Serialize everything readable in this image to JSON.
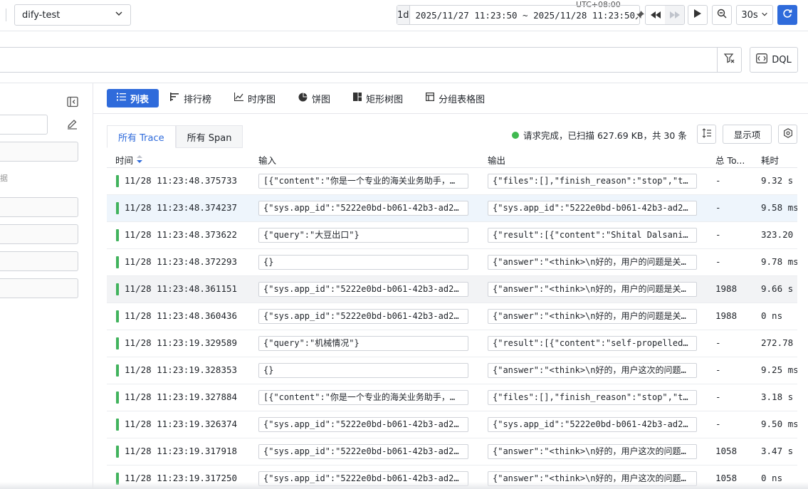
{
  "topbar": {
    "workspace": "dify-test",
    "timezone": "UTC+08:00",
    "quick_range": "1d",
    "time_range": "2025/11/27 11:23:50 ~ 2025/11/28 11:23:50",
    "refresh_interval": "30s"
  },
  "search": {
    "dql_label": "DQL"
  },
  "left_panel": {
    "hint_text": "据"
  },
  "view_tabs": [
    {
      "label": "列表",
      "icon": "list-icon"
    },
    {
      "label": "排行榜",
      "icon": "ranking-icon"
    },
    {
      "label": "时序图",
      "icon": "timeseries-icon"
    },
    {
      "label": "饼图",
      "icon": "pie-icon"
    },
    {
      "label": "矩形树图",
      "icon": "treemap-icon"
    },
    {
      "label": "分组表格图",
      "icon": "group-table-icon"
    }
  ],
  "sub_tabs": [
    "所有 Trace",
    "所有 Span"
  ],
  "status_text": "请求完成，已扫描 627.69 KB，共 30 条",
  "display_button": "显示项",
  "table": {
    "columns": {
      "time": "时间",
      "input": "输入",
      "output": "输出",
      "tokens": "总 To...",
      "duration": "耗时"
    },
    "rows": [
      {
        "time": "11/28 11:23:48.375733",
        "input": "[{\"content\":\"你是一个专业的海关业务助手，具有丰富的海关知识\"}]",
        "output": "{\"files\":[],\"finish_reason\":\"stop\",\"text\":\"\"}",
        "tokens": "-",
        "duration": "9.32 s"
      },
      {
        "time": "11/28 11:23:48.374237",
        "input": "{\"sys.app_id\":\"5222e0bd-b061-42b3-ad2...",
        "output": "{\"sys.app_id\":\"5222e0bd-b061-42b3-ad2...",
        "tokens": "-",
        "duration": "9.58 ms"
      },
      {
        "time": "11/28 11:23:48.373622",
        "input": "{\"query\":\"大豆出口\"}",
        "output": "{\"result\":[{\"content\":\"Shital Dalsania\"}]}",
        "tokens": "-",
        "duration": "323.20"
      },
      {
        "time": "11/28 11:23:48.372293",
        "input": "{}",
        "output": "{\"answer\":\"<think>\\n好的，用户的问题是关于大豆出口\"}",
        "tokens": "-",
        "duration": "9.78 ms"
      },
      {
        "time": "11/28 11:23:48.361151",
        "input": "{\"sys.app_id\":\"5222e0bd-b061-42b3-ad2...",
        "output": "{\"answer\":\"<think>\\n好的，用户的问题是关于大豆出口\"}",
        "tokens": "1988",
        "duration": "9.66 s"
      },
      {
        "time": "11/28 11:23:48.360436",
        "input": "{\"sys.app_id\":\"5222e0bd-b061-42b3-ad2...",
        "output": "{\"answer\":\"<think>\\n好的，用户的问题是关于大豆出口\"}",
        "tokens": "1988",
        "duration": "0 ns"
      },
      {
        "time": "11/28 11:23:19.329589",
        "input": "{\"query\":\"机械情况\"}",
        "output": "{\"result\":[{\"content\":\"self-propelled machinery\"}]}",
        "tokens": "-",
        "duration": "272.78"
      },
      {
        "time": "11/28 11:23:19.328353",
        "input": "{}",
        "output": "{\"answer\":\"<think>\\n好的，用户这次的问题是关于机械\"}",
        "tokens": "-",
        "duration": "9.25 ms"
      },
      {
        "time": "11/28 11:23:19.327884",
        "input": "[{\"content\":\"你是一个专业的海关业务助手，具有丰富的海关知识\"}]",
        "output": "{\"files\":[],\"finish_reason\":\"stop\",\"text\":\"\"}",
        "tokens": "-",
        "duration": "3.18 s"
      },
      {
        "time": "11/28 11:23:19.326374",
        "input": "{\"sys.app_id\":\"5222e0bd-b061-42b3-ad2...",
        "output": "{\"sys.app_id\":\"5222e0bd-b061-42b3-ad2...",
        "tokens": "-",
        "duration": "9.50 ms"
      },
      {
        "time": "11/28 11:23:19.317918",
        "input": "{\"sys.app_id\":\"5222e0bd-b061-42b3-ad2...",
        "output": "{\"answer\":\"<think>\\n好的，用户这次的问题是关于机械\"}",
        "tokens": "1058",
        "duration": "3.47 s"
      },
      {
        "time": "11/28 11:23:19.317250",
        "input": "{\"sys.app_id\":\"5222e0bd-b061-42b3-ad2...",
        "output": "{\"answer\":\"<think>\\n好的，用户这次的问题是关于机械\"}",
        "tokens": "1058",
        "duration": "0 ns"
      }
    ]
  },
  "colors": {
    "accent": "#2f6bdb",
    "status_ok": "#41b35d",
    "row_highlight": "#eef5fc"
  }
}
